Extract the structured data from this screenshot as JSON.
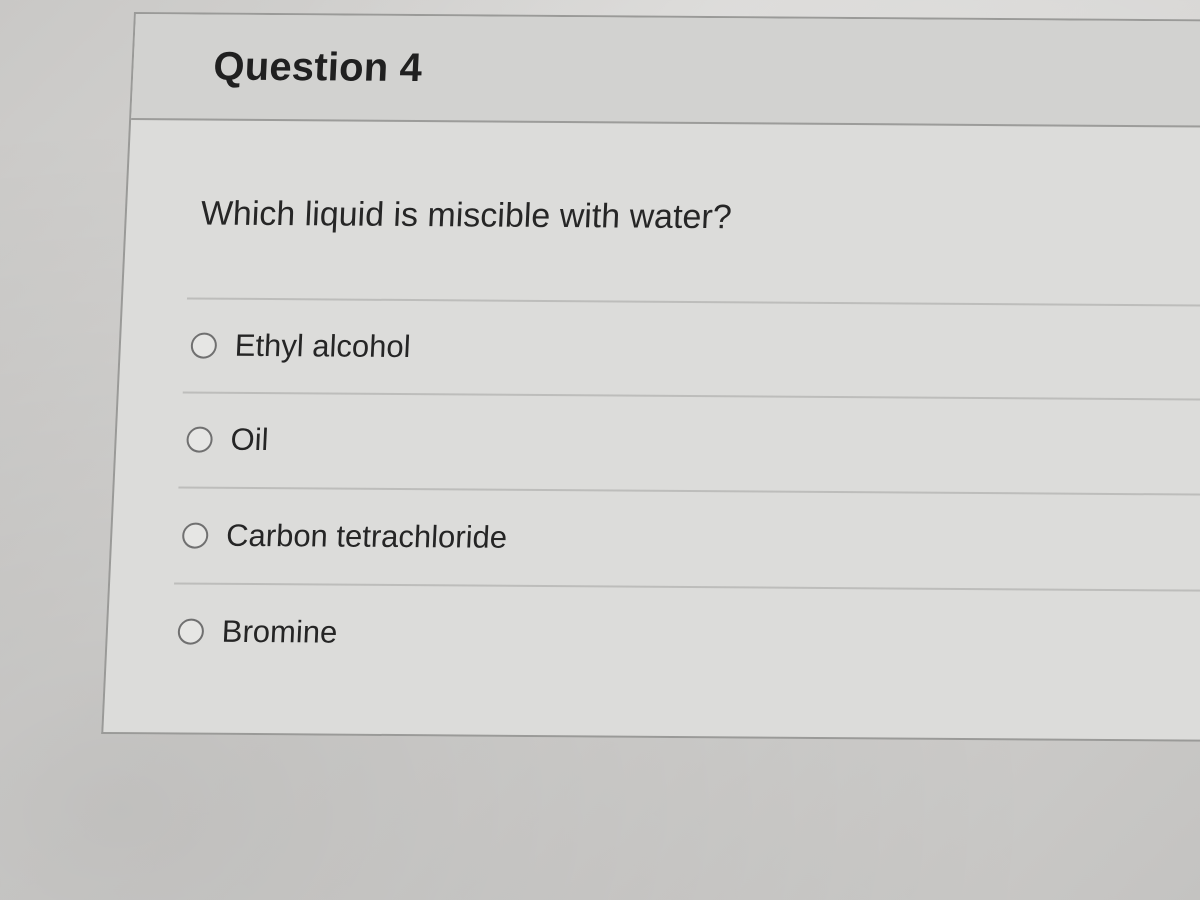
{
  "question": {
    "title": "Question 4",
    "prompt": "Which liquid is miscible with water?"
  },
  "answers": [
    {
      "label": "Ethyl alcohol",
      "selected": false
    },
    {
      "label": "Oil",
      "selected": false
    },
    {
      "label": "Carbon tetrachloride",
      "selected": false
    },
    {
      "label": "Bromine",
      "selected": false
    }
  ],
  "colors": {
    "card_background": "#dcdcda",
    "header_background": "#d2d2d0",
    "text": "#202020",
    "radio_border": "#707070"
  }
}
